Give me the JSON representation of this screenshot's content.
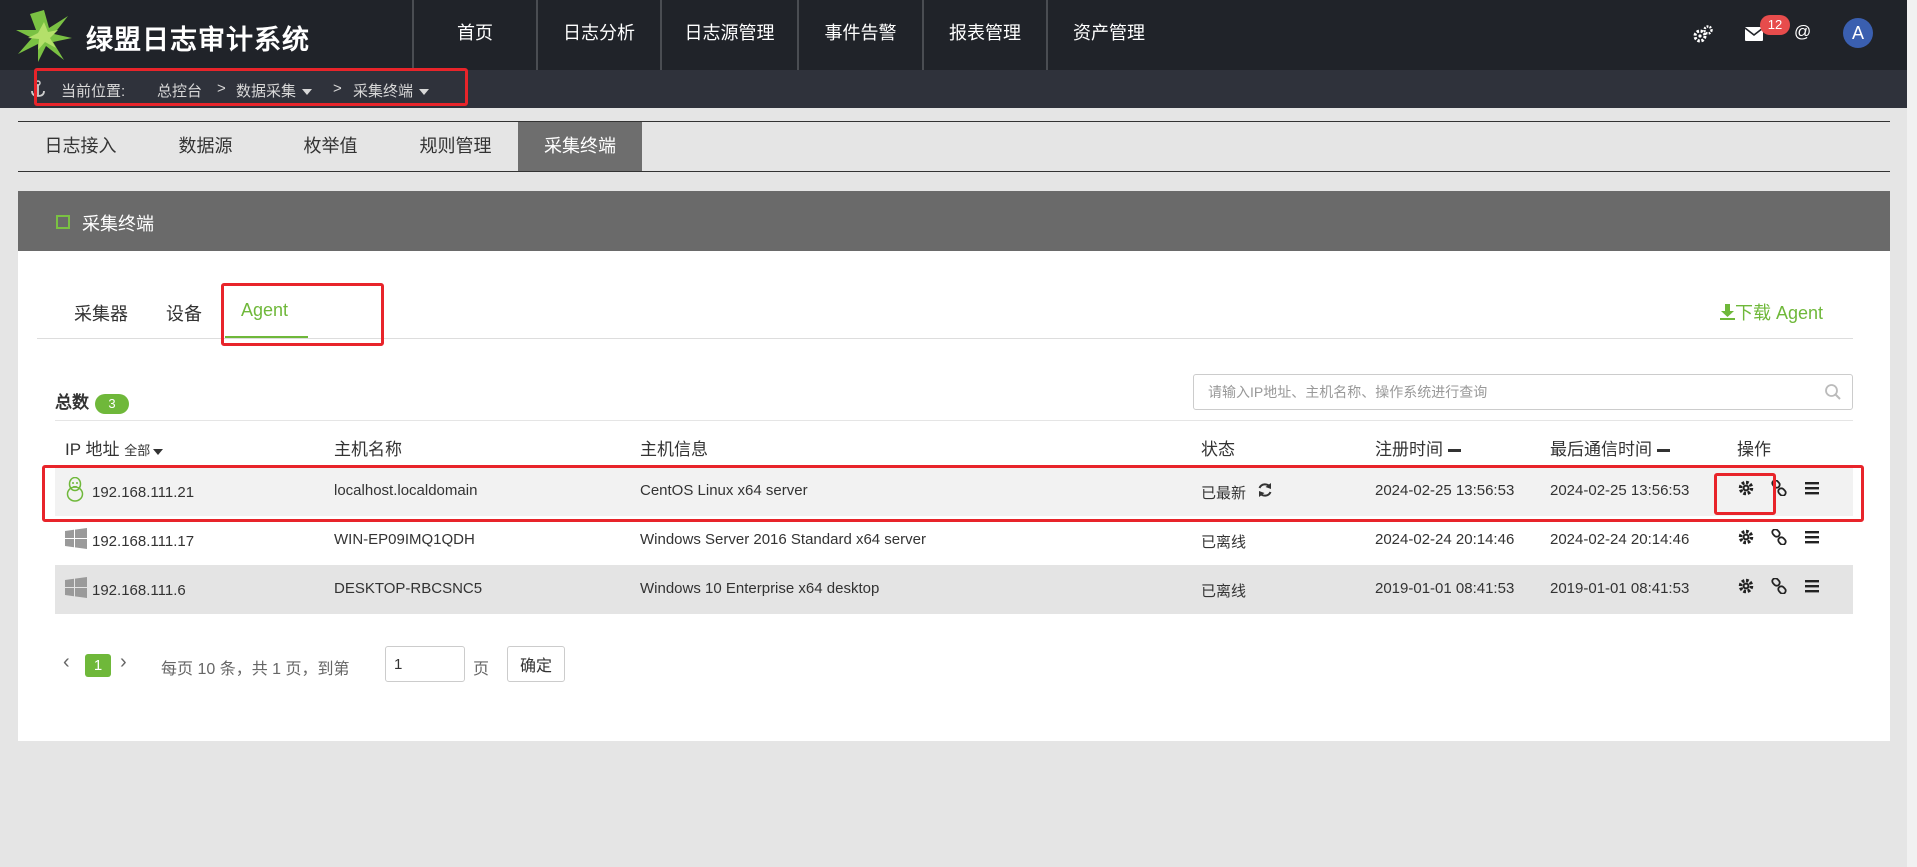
{
  "app": {
    "title": "绿盟日志审计系统"
  },
  "nav": [
    "首页",
    "日志分析",
    "日志源管理",
    "事件告警",
    "报表管理",
    "资产管理"
  ],
  "header": {
    "mail_badge": "12",
    "at_symbol": "@",
    "avatar_letter": "A"
  },
  "breadcrumb": {
    "label": "当前位置:",
    "home": "总控台",
    "level1": "数据采集",
    "level2": "采集终端",
    "sep": ">"
  },
  "module_tabs": [
    "日志接入",
    "数据源",
    "枚举值",
    "规则管理",
    "采集终端"
  ],
  "panel": {
    "title": "采集终端",
    "subtabs": [
      "采集器",
      "设备",
      "Agent"
    ],
    "download_label": "下载 Agent",
    "total_label": "总数",
    "total_count": "3",
    "search_placeholder": "请输入IP地址、主机名称、操作系统进行查询"
  },
  "table": {
    "headers": {
      "ip": "IP 地址",
      "ip_filter": "全部",
      "host": "主机名称",
      "info": "主机信息",
      "status": "状态",
      "reg": "注册时间",
      "last": "最后通信时间",
      "ops": "操作"
    },
    "rows": [
      {
        "os": "linux",
        "ip": "192.168.111.21",
        "host": "localhost.localdomain",
        "info": "CentOS Linux x64 server",
        "status": "已最新",
        "reg": "2024-02-25 13:56:53",
        "last": "2024-02-25 13:56:53"
      },
      {
        "os": "windows",
        "ip": "192.168.111.17",
        "host": "WIN-EP09IMQ1QDH",
        "info": "Windows Server 2016 Standard x64 server",
        "status": "已离线",
        "reg": "2024-02-24 20:14:46",
        "last": "2024-02-24 20:14:46"
      },
      {
        "os": "windows",
        "ip": "192.168.111.6",
        "host": "DESKTOP-RBCSNC5",
        "info": "Windows 10 Enterprise x64 desktop",
        "status": "已离线",
        "reg": "2019-01-01 08:41:53",
        "last": "2019-01-01 08:41:53"
      }
    ]
  },
  "pager": {
    "prev": "‹",
    "next": "›",
    "current": "1",
    "text": "每页 10 条，共 1 页，到第",
    "goto_value": "1",
    "page_unit": "页",
    "ok_label": "确定"
  },
  "icons": {
    "logo": "star-burst-logo",
    "settings": "gears-icon",
    "mail": "mail-icon",
    "anchor": "anchor-icon",
    "download": "download-icon",
    "search": "search-icon",
    "refresh": "refresh-icon",
    "config": "gear-icon",
    "link": "link-icon",
    "menu": "menu-icon",
    "linux": "linux-tux-icon",
    "windows": "windows-icon"
  },
  "colors": {
    "accent": "#6fb83a",
    "topbar": "#202329",
    "crumbbar": "#2f323b",
    "highlight": "#e8242a",
    "badge": "#e74c4c"
  }
}
